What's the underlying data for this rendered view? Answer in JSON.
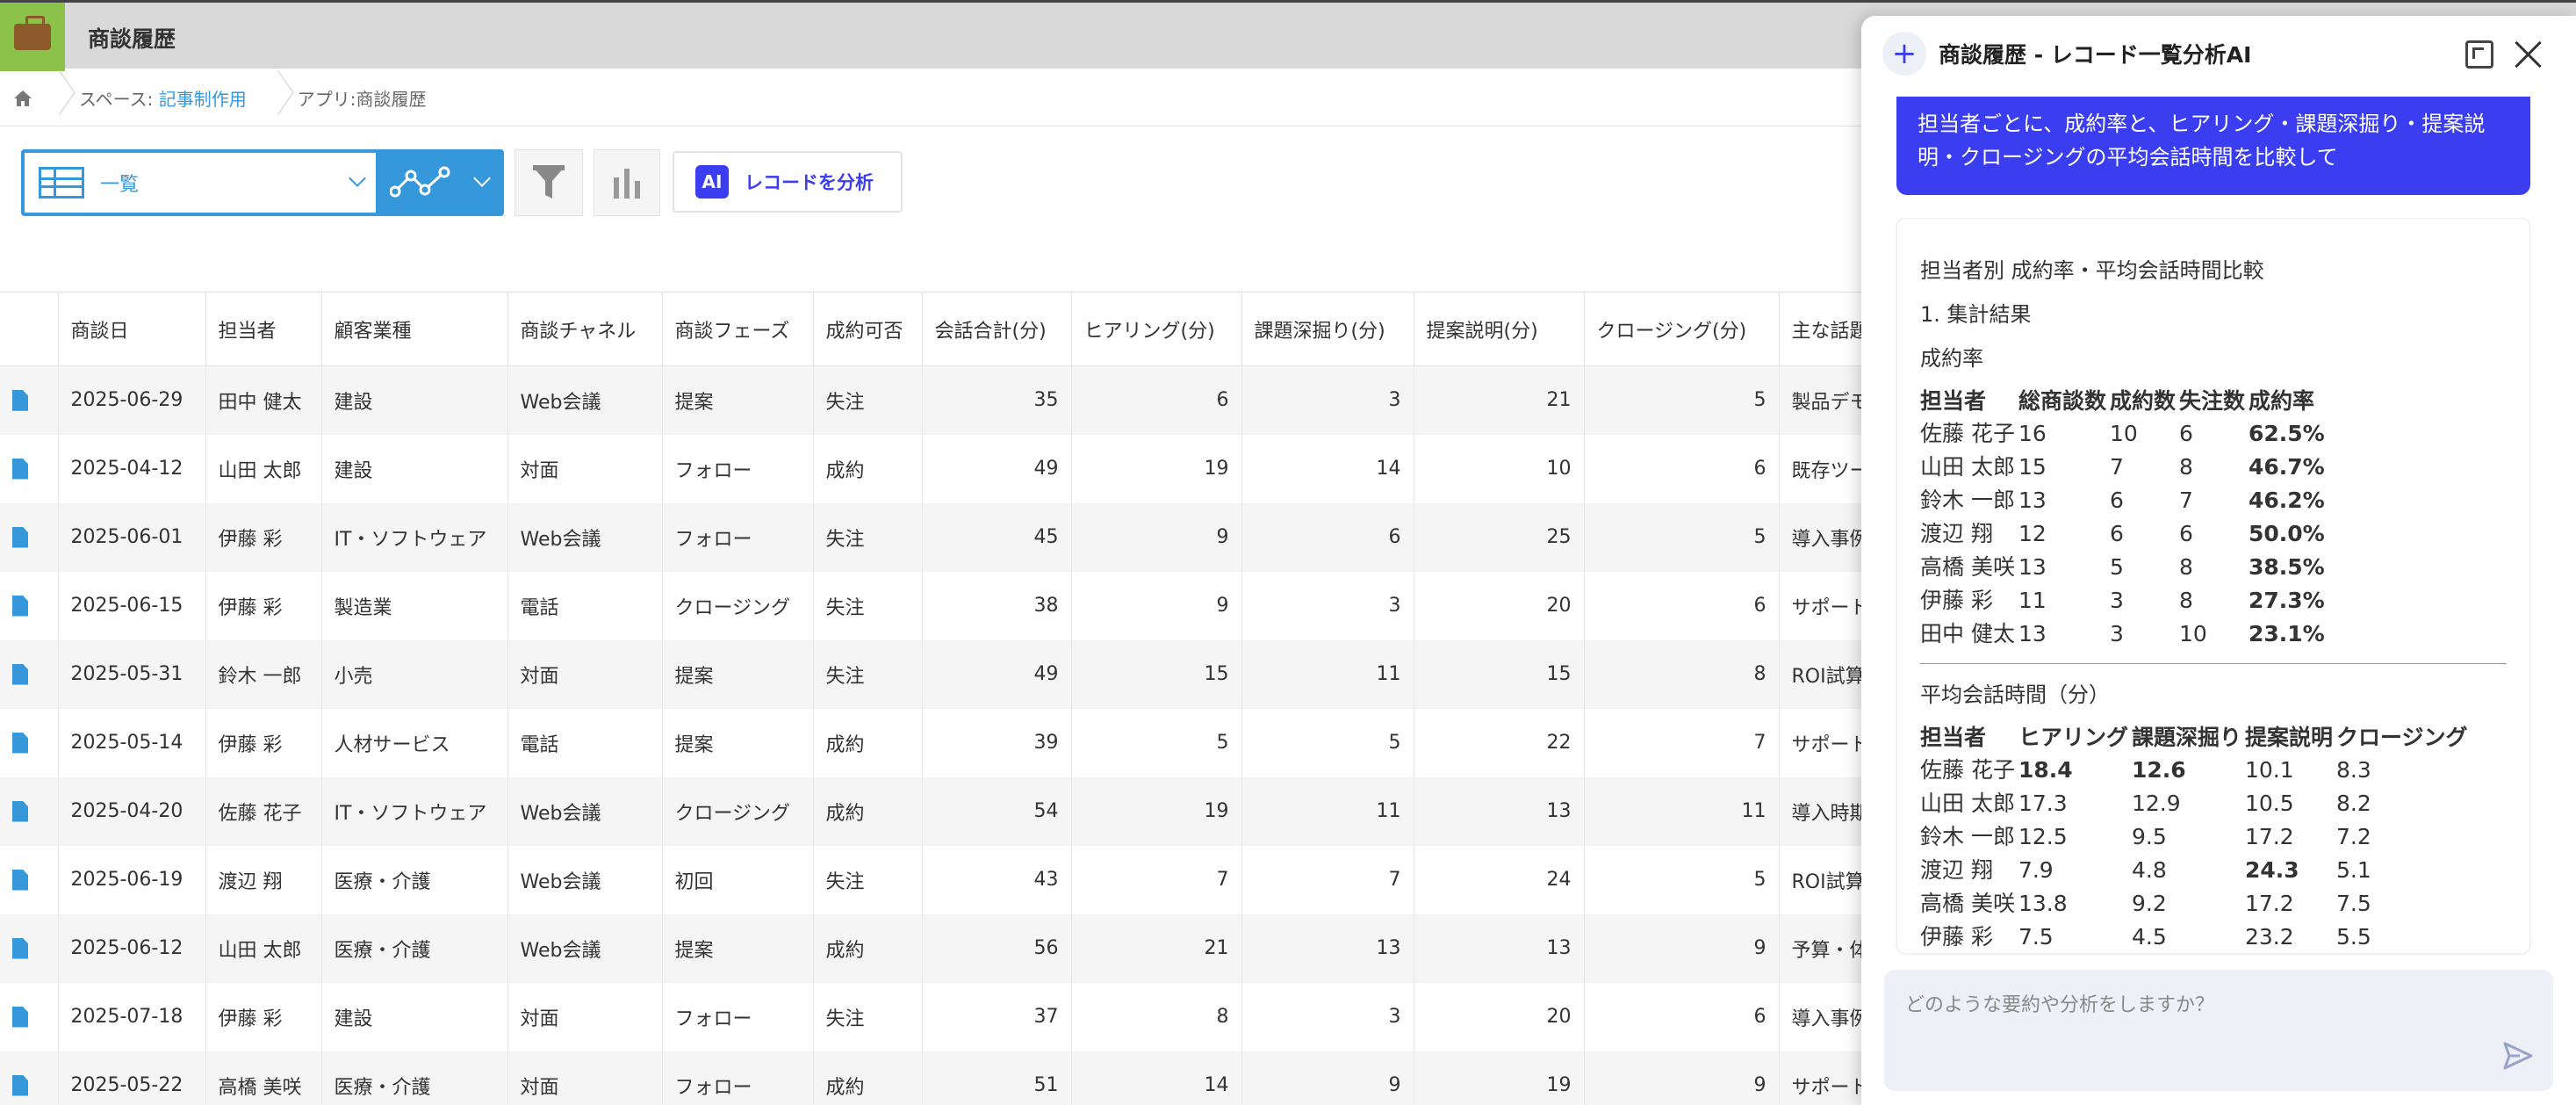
{
  "app": {
    "title": "商談履歴"
  },
  "breadcrumb": {
    "space_prefix": "スペース:",
    "space_name": "記事制作用",
    "app_prefix": "アプリ:",
    "app_name": "商談履歴"
  },
  "toolbar": {
    "view_label": "一覧",
    "analyze_label": "レコードを分析",
    "ai_badge": "AI"
  },
  "table": {
    "columns": [
      "商談日",
      "担当者",
      "顧客業種",
      "商談チャネル",
      "商談フェーズ",
      "成約可否",
      "会話合計(分)",
      "ヒアリング(分)",
      "課題深掘り(分)",
      "提案説明(分)",
      "クロージング(分)",
      "主な話題"
    ],
    "rows": [
      [
        "2025-06-29",
        "田中 健太",
        "建設",
        "Web会議",
        "提案",
        "失注",
        "35",
        "6",
        "3",
        "21",
        "5",
        "製品デモ"
      ],
      [
        "2025-04-12",
        "山田 太郎",
        "建設",
        "対面",
        "フォロー",
        "成約",
        "49",
        "19",
        "14",
        "10",
        "6",
        "既存ツール"
      ],
      [
        "2025-06-01",
        "伊藤 彩",
        "IT・ソフトウェア",
        "Web会議",
        "フォロー",
        "失注",
        "45",
        "9",
        "6",
        "25",
        "5",
        "導入事例の"
      ],
      [
        "2025-06-15",
        "伊藤 彩",
        "製造業",
        "電話",
        "クロージング",
        "失注",
        "38",
        "9",
        "3",
        "20",
        "6",
        "サポート体"
      ],
      [
        "2025-05-31",
        "鈴木 一郎",
        "小売",
        "対面",
        "提案",
        "失注",
        "49",
        "15",
        "11",
        "15",
        "8",
        "ROI試算の"
      ],
      [
        "2025-05-14",
        "伊藤 彩",
        "人材サービス",
        "電話",
        "提案",
        "成約",
        "39",
        "5",
        "5",
        "22",
        "7",
        "サポート体"
      ],
      [
        "2025-04-20",
        "佐藤 花子",
        "IT・ソフトウェア",
        "Web会議",
        "クロージング",
        "成約",
        "54",
        "19",
        "11",
        "13",
        "11",
        "導入時期の"
      ],
      [
        "2025-06-19",
        "渡辺 翔",
        "医療・介護",
        "Web会議",
        "初回",
        "失注",
        "43",
        "7",
        "7",
        "24",
        "5",
        "ROI試算の"
      ],
      [
        "2025-06-12",
        "山田 太郎",
        "医療・介護",
        "Web会議",
        "提案",
        "成約",
        "56",
        "21",
        "13",
        "13",
        "9",
        "予算・体制"
      ],
      [
        "2025-07-18",
        "伊藤 彩",
        "建設",
        "対面",
        "フォロー",
        "失注",
        "37",
        "8",
        "3",
        "20",
        "6",
        "導入事例の"
      ],
      [
        "2025-05-22",
        "高橋 美咲",
        "医療・介護",
        "対面",
        "フォロー",
        "成約",
        "51",
        "14",
        "9",
        "19",
        "9",
        "サポート体"
      ]
    ]
  },
  "panel": {
    "title": "商談履歴 - レコード一覧分析AI",
    "user_message": "担当者ごとに、成約率と、ヒアリング・課題深掘り・提案説明・クロージングの平均会話時間を比較して",
    "answer_title": "担当者別 成約率・平均会話時間比較",
    "section1": "1. 集計結果",
    "rate_heading": "成約率",
    "rate_columns": [
      "担当者",
      "総商談数",
      "成約数",
      "失注数",
      "成約率"
    ],
    "rate_rows": [
      [
        "佐藤 花子",
        "16",
        "10",
        "6",
        "62.5%"
      ],
      [
        "山田 太郎",
        "15",
        "7",
        "8",
        "46.7%"
      ],
      [
        "鈴木 一郎",
        "13",
        "6",
        "7",
        "46.2%"
      ],
      [
        "渡辺 翔",
        "12",
        "6",
        "6",
        "50.0%"
      ],
      [
        "高橋 美咲",
        "13",
        "5",
        "8",
        "38.5%"
      ],
      [
        "伊藤 彩",
        "11",
        "3",
        "8",
        "27.3%"
      ],
      [
        "田中 健太",
        "13",
        "3",
        "10",
        "23.1%"
      ]
    ],
    "time_heading": "平均会話時間（分）",
    "time_columns": [
      "担当者",
      "ヒアリング",
      "課題深掘り",
      "提案説明",
      "クロージング"
    ],
    "time_rows": [
      [
        "佐藤 花子",
        "18.4",
        "12.6",
        "10.1",
        "8.3"
      ],
      [
        "山田 太郎",
        "17.3",
        "12.9",
        "10.5",
        "8.2"
      ],
      [
        "鈴木 一郎",
        "12.5",
        "9.5",
        "17.2",
        "7.2"
      ],
      [
        "渡辺 翔",
        "7.9",
        "4.8",
        "24.3",
        "5.1"
      ],
      [
        "高橋 美咲",
        "13.8",
        "9.2",
        "17.2",
        "7.5"
      ],
      [
        "伊藤 彩",
        "7.5",
        "4.5",
        "23.2",
        "5.5"
      ]
    ],
    "prompt_placeholder": "どのような要約や分析をしますか？"
  },
  "colors": {
    "accent": "#3498db",
    "ai": "#3b3ef0",
    "app_icon": "#8bc34a"
  },
  "icons": [
    "briefcase-icon",
    "home-icon",
    "table-icon",
    "line-chart-icon",
    "filter-icon",
    "bar-chart-icon",
    "document-icon",
    "plus-icon",
    "expand-icon",
    "close-icon",
    "send-icon"
  ]
}
